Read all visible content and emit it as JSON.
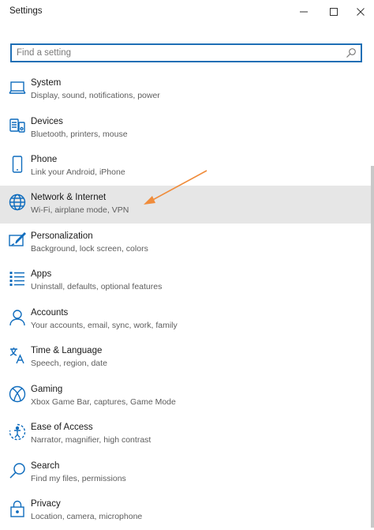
{
  "window": {
    "title": "Settings"
  },
  "search": {
    "placeholder": "Find a setting"
  },
  "colors": {
    "accent": "#1f6fb5",
    "icon": "#0f6cbd",
    "selected_bg": "#e6e6e6",
    "arrow": "#f08c3b"
  },
  "items": [
    {
      "icon": "laptop-icon",
      "name": "System",
      "desc": "Display, sound, notifications, power"
    },
    {
      "icon": "devices-icon",
      "name": "Devices",
      "desc": "Bluetooth, printers, mouse"
    },
    {
      "icon": "phone-icon",
      "name": "Phone",
      "desc": "Link your Android, iPhone"
    },
    {
      "icon": "globe-icon",
      "name": "Network & Internet",
      "desc": "Wi-Fi, airplane mode, VPN",
      "selected": true
    },
    {
      "icon": "paintbrush-icon",
      "name": "Personalization",
      "desc": "Background, lock screen, colors"
    },
    {
      "icon": "apps-list-icon",
      "name": "Apps",
      "desc": "Uninstall, defaults, optional features"
    },
    {
      "icon": "person-icon",
      "name": "Accounts",
      "desc": "Your accounts, email, sync, work, family"
    },
    {
      "icon": "language-icon",
      "name": "Time & Language",
      "desc": "Speech, region, date"
    },
    {
      "icon": "xbox-icon",
      "name": "Gaming",
      "desc": "Xbox Game Bar, captures, Game Mode"
    },
    {
      "icon": "ease-of-access-icon",
      "name": "Ease of Access",
      "desc": "Narrator, magnifier, high contrast"
    },
    {
      "icon": "search-icon",
      "name": "Search",
      "desc": "Find my files, permissions"
    },
    {
      "icon": "lock-icon",
      "name": "Privacy",
      "desc": "Location, camera, microphone"
    }
  ]
}
